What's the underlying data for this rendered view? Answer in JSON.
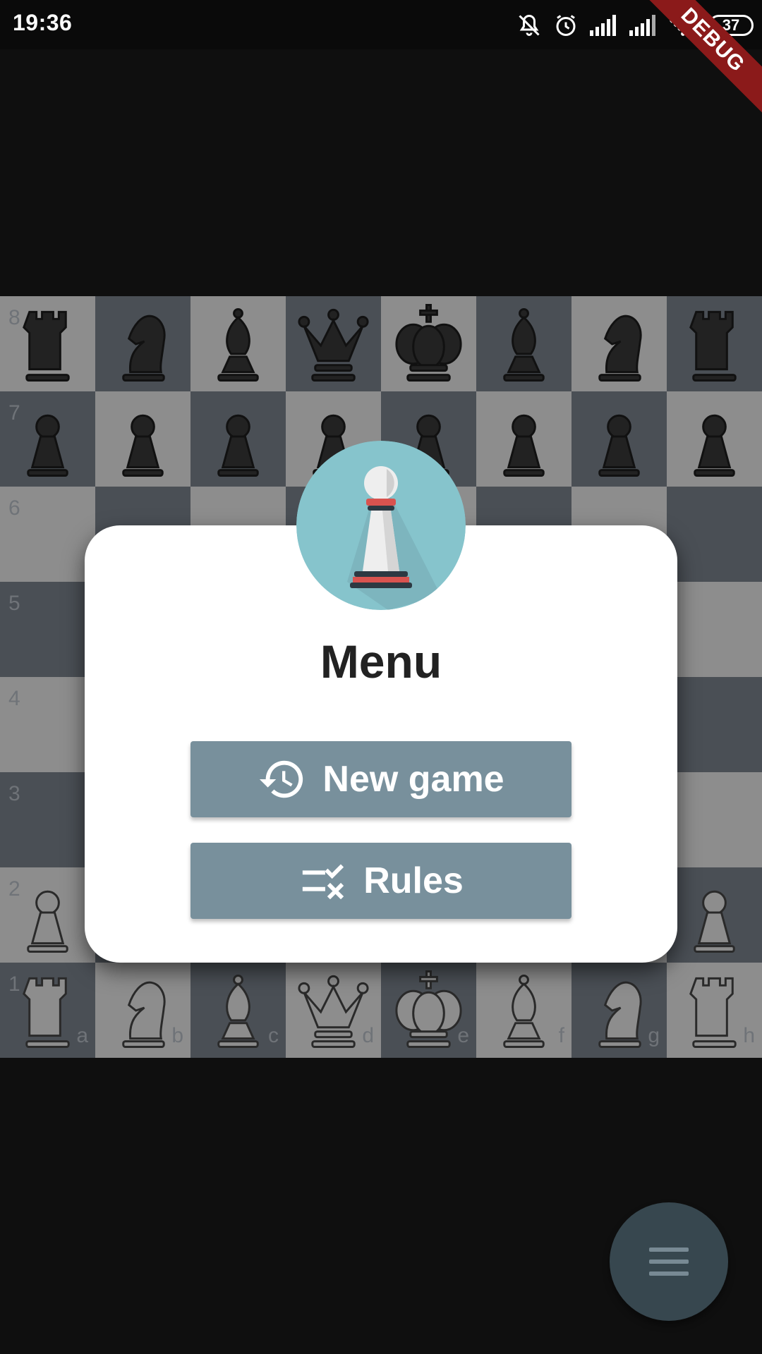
{
  "status_bar": {
    "time": "19:36",
    "battery": "37",
    "icons": [
      "mute-icon",
      "alarm-icon",
      "signal-icon",
      "signal-icon-2",
      "wifi-icon",
      "battery-icon"
    ]
  },
  "debug_banner": "DEBUG",
  "board": {
    "ranks": [
      "8",
      "7",
      "6",
      "5",
      "4",
      "3",
      "2",
      "1"
    ],
    "files": [
      "a",
      "b",
      "c",
      "d",
      "e",
      "f",
      "g",
      "h"
    ],
    "colors": {
      "light": "#8d8d8d",
      "dark": "#4a4f55",
      "black_piece": "#222222",
      "white_piece": "#8d8d8d"
    },
    "pieces": {
      "8": [
        "black-rook",
        "black-knight",
        "black-bishop",
        "black-queen",
        "black-king",
        "black-bishop",
        "black-knight",
        "black-rook"
      ],
      "7": [
        "black-pawn",
        "black-pawn",
        "black-pawn",
        "black-pawn",
        "black-pawn",
        "black-pawn",
        "black-pawn",
        "black-pawn"
      ],
      "2": [
        "white-pawn",
        "",
        "",
        "",
        "",
        "",
        "",
        "white-pawn"
      ],
      "1": [
        "white-rook",
        "white-knight",
        "white-bishop",
        "white-queen",
        "white-king",
        "white-bishop",
        "white-knight",
        "white-rook"
      ]
    }
  },
  "menu_dialog": {
    "title": "Menu",
    "avatar_icon": "pawn-logo-icon",
    "avatar_color": "#86c4cc",
    "buttons": [
      {
        "label": "New game",
        "icon": "history-icon"
      },
      {
        "label": "Rules",
        "icon": "rule-icon"
      }
    ],
    "button_color": "#78909c"
  },
  "fab": {
    "icon": "menu-icon",
    "color": "#37474f"
  }
}
